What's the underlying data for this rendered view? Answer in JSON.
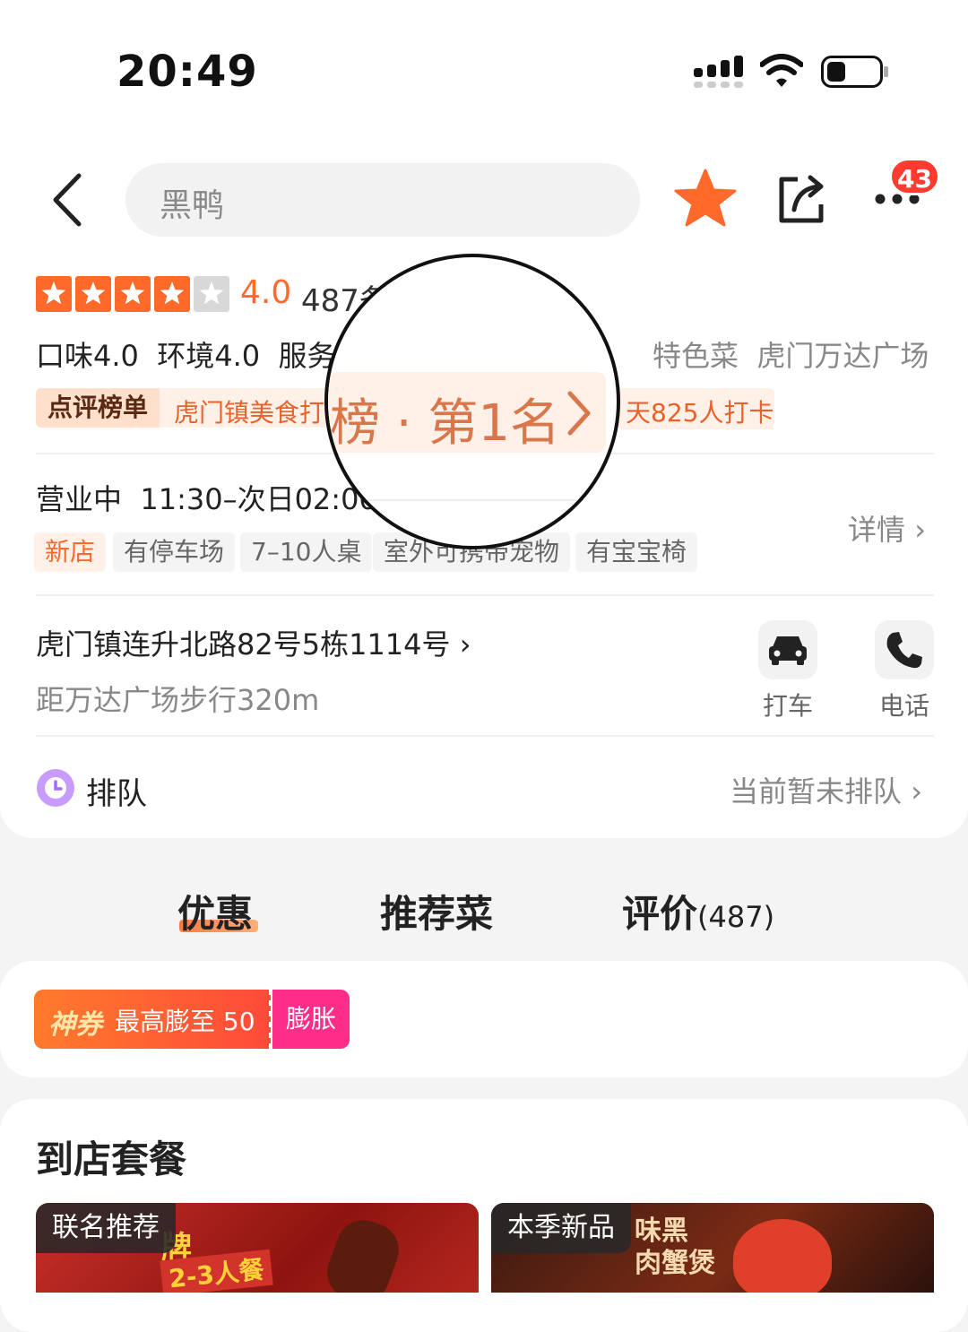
{
  "status_bar": {
    "time": "20:49"
  },
  "header": {
    "back_icon": "chevron-left-icon",
    "search_text": "黑鸭",
    "favorite_icon": "star-icon",
    "share_icon": "share-icon",
    "more_icon": "more-dots-icon",
    "notification_count": "43"
  },
  "summary": {
    "stars": 4,
    "rating": "4.0",
    "reviews": "487条",
    "sub_scores": "口味4.0  环境4.0  服务",
    "categories": "特色菜  虎门万达广场",
    "rank_label": "点评榜单",
    "rank_text": "虎门镇美食打卡榜 · 第1名 >",
    "rank_magnified": "榜 · 第1名",
    "rank_count": "天825人打卡",
    "hours": "营业中  11:30–次日02:00",
    "details_link": "详情",
    "tags": [
      "新店",
      "有停车场",
      "7–10人桌",
      "室外可携带宠物",
      "有宝宝椅"
    ],
    "address": "虎门镇连升北路82号5栋1114号",
    "distance": "距万达广场步行320m",
    "taxi_label": "打车",
    "phone_label": "电话",
    "queue_label": "排队",
    "queue_status": "当前暂未排队"
  },
  "tabs": [
    {
      "label": "优惠",
      "active": true
    },
    {
      "label": "推荐菜",
      "active": false
    },
    {
      "label": "评价",
      "count": "(487)",
      "active": false
    }
  ],
  "coupon": {
    "brand": "神券",
    "text": "最高膨至 50",
    "action": "膨胀"
  },
  "packages": {
    "title": "到店套餐",
    "items": [
      {
        "label": "联名推荐",
        "overlay": "2-3人餐",
        "overlay2": "牌"
      },
      {
        "label": "本季新品",
        "overlay": "味黑 肉蟹煲"
      }
    ]
  },
  "colors": {
    "accent": "#ff6a2b",
    "coupon_start": "#ff5e2c",
    "coupon_pink": "#ff2d8a"
  }
}
